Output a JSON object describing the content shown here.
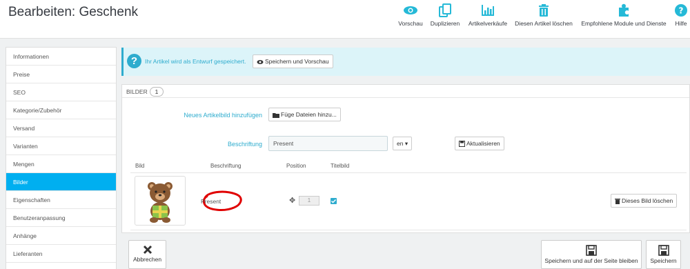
{
  "header": {
    "title": "Bearbeiten: Geschenk",
    "toolbar": [
      {
        "label": "Vorschau",
        "icon": "eye-icon"
      },
      {
        "label": "Duplizieren",
        "icon": "copy-icon"
      },
      {
        "label": "Artikelverkäufe",
        "icon": "bar-chart-icon"
      },
      {
        "label": "Diesen Artikel löschen",
        "icon": "trash-icon"
      },
      {
        "label": "Empfohlene Module und Dienste",
        "icon": "puzzle-icon"
      },
      {
        "label": "Hilfe",
        "icon": "help-icon"
      }
    ]
  },
  "sidebar": {
    "items": [
      {
        "label": "Informationen"
      },
      {
        "label": "Preise"
      },
      {
        "label": "SEO"
      },
      {
        "label": "Kategorie/Zubehör"
      },
      {
        "label": "Versand"
      },
      {
        "label": "Varianten"
      },
      {
        "label": "Mengen"
      },
      {
        "label": "Bilder",
        "active": true
      },
      {
        "label": "Eigenschaften"
      },
      {
        "label": "Benutzeranpassung"
      },
      {
        "label": "Anhänge"
      },
      {
        "label": "Lieferanten"
      }
    ]
  },
  "info": {
    "text": "Ihr Artikel wird als Entwurf gespeichert.",
    "button": "Speichern und Vorschau"
  },
  "panel": {
    "title": "BILDER",
    "count": "1",
    "add_label": "Neues Artikelbild hinzufügen",
    "add_button": "Füge Dateien hinzu...",
    "caption_label": "Beschriftung",
    "caption_value": "Present",
    "lang": "en",
    "update_button": "Aktualisieren",
    "columns": [
      "Bild",
      "Beschriftung",
      "Position",
      "Titelbild"
    ],
    "row": {
      "caption": "Present",
      "position": "1",
      "cover": true,
      "image": "teddy-bear-gift-image"
    },
    "delete_button": "Dieses Bild löschen"
  },
  "footer": {
    "cancel": "Abbrechen",
    "save_stay": "Speichern und auf der Seite bleiben",
    "save": "Speichern"
  },
  "colors": {
    "accent": "#00aff0",
    "info": "#2eacce",
    "annotation": "#e00000"
  }
}
